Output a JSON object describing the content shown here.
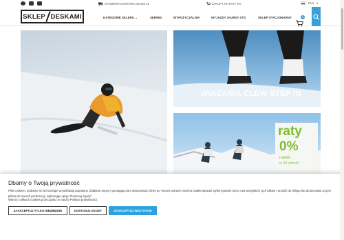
{
  "topbar": {
    "socials": [
      "facebook-icon",
      "instagram-icon",
      "youtube-icon"
    ],
    "shipping": "DARMOWA DOSTAWA OD 500 ZŁ",
    "installments": "ZAKUPY NA RATY 0%",
    "currency": "PLN"
  },
  "header": {
    "logo_left": "SKLEP",
    "logo_right": "DESKAMI",
    "nav": [
      "KATEGORIE SKLEPU",
      "SERWIS",
      "WYPOŻYCZALNIA",
      "WYJAZDY I KURSY STS",
      "SKLEP STACJONARNY"
    ],
    "cart_count": "0"
  },
  "banners": {
    "bindings_caption": "WIĄZANIA CLEW STEP IN",
    "raty_line1": "raty",
    "raty_line2": "0%",
    "raty_line3": "nawet",
    "raty_line4": "w 15 minut!"
  },
  "cookie": {
    "title": "Dbamy o Twoją prywatność",
    "text": "Pliki cookies i podobne im technologie umożliwiają poprawne działanie strony i pomagają nam dostosować oferty do Twoich potrzeb. Możesz zaakceptować wykorzystanie przez nas wszystkich tych plików i przejść do sklepu lub dostosować użycie plików do swoich preferencji, wybierając opcję \"Dostosuj zgody\".",
    "link": "Więcej o plikach cookies przeczytasz w naszej Polityce prywatności.",
    "btn_necessary": "ZAAKCEPTUJ TYLKO NIEZBĘDNE",
    "btn_customize": "DOSTOSUJ ZGODY",
    "btn_all": "ZAAKCEPTUJ WSZYSTKIE"
  },
  "colors": {
    "accent": "#2aa3e0",
    "raty_green": "#7dbd2f"
  }
}
